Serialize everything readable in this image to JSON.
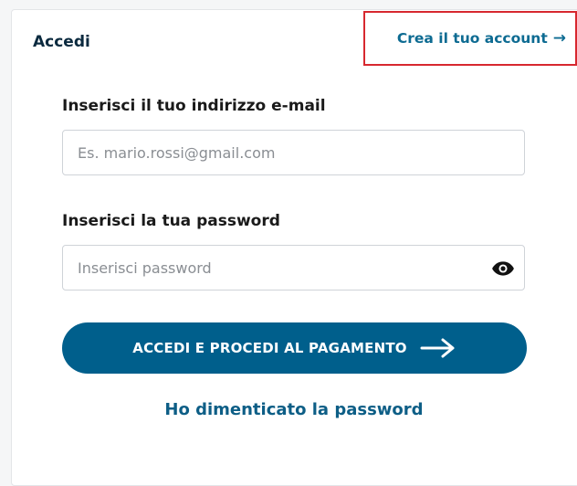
{
  "header": {
    "title": "Accedi",
    "create_account_label": "Crea il tuo account",
    "create_account_arrow": "→"
  },
  "form": {
    "email_label": "Inserisci il tuo indirizzo e-mail",
    "email_placeholder": "Es. mario.rossi@gmail.com",
    "email_value": "",
    "password_label": "Inserisci la tua password",
    "password_placeholder": "Inserisci password",
    "password_value": "",
    "password_toggle_icon": "eye-icon",
    "submit_label": "ACCEDI E PROCEDI AL PAGAMENTO",
    "submit_icon": "arrow-right-icon",
    "forgot_label": "Ho dimenticato la password"
  },
  "colors": {
    "primary": "#005f8c",
    "link": "#0d6b92",
    "highlight_border": "#d7282f"
  }
}
